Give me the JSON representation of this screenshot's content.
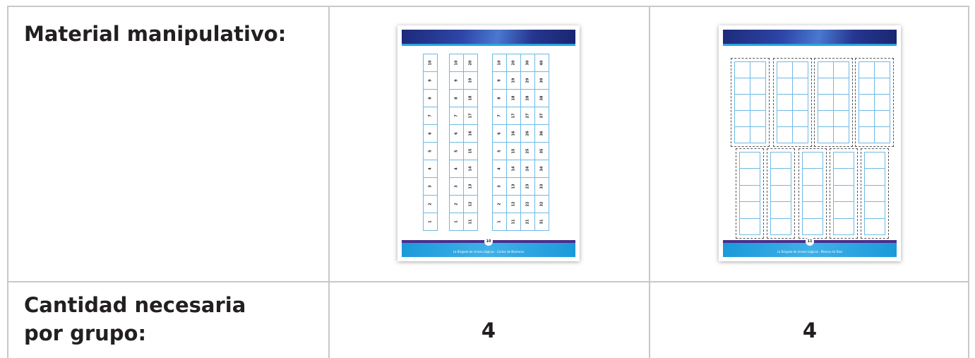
{
  "table": {
    "row1_label": "Material manipulativo:",
    "row2_label_line1": "Cantidad necesaria",
    "row2_label_line2": "por grupo:",
    "quantity_col2": "4",
    "quantity_col3": "4"
  },
  "sheet1": {
    "page_number": "10",
    "footer_text": "La Brigada de Líneas Lógicas · Cartas de Números",
    "cards_col1": [
      "10",
      "9",
      "8",
      "7",
      "6",
      "5",
      "4",
      "3",
      "2",
      "1"
    ],
    "cards_col2": [
      "10",
      "9",
      "8",
      "7",
      "6",
      "5",
      "4",
      "3",
      "2",
      "1"
    ],
    "cards_col3": [
      "20",
      "19",
      "18",
      "17",
      "16",
      "15",
      "14",
      "13",
      "12",
      "11"
    ],
    "cards_col4": [
      "10",
      "9",
      "8",
      "7",
      "6",
      "5",
      "4",
      "3",
      "2",
      "1"
    ],
    "cards_col5": [
      "20",
      "19",
      "18",
      "17",
      "16",
      "15",
      "14",
      "13",
      "12",
      "11"
    ],
    "cards_col6": [
      "30",
      "29",
      "28",
      "27",
      "26",
      "25",
      "24",
      "23",
      "22",
      "21"
    ],
    "cards_col7": [
      "40",
      "39",
      "38",
      "37",
      "36",
      "35",
      "34",
      "33",
      "32",
      "31"
    ]
  },
  "sheet2": {
    "page_number": "11",
    "footer_text": "La Brigada de Líneas Lógicas · Marcos de Diez"
  },
  "colors": {
    "border": "#c8c8c8",
    "banner": "#1c2a7a",
    "accent": "#2aa4e0",
    "grid_line": "#6fb9e3"
  }
}
